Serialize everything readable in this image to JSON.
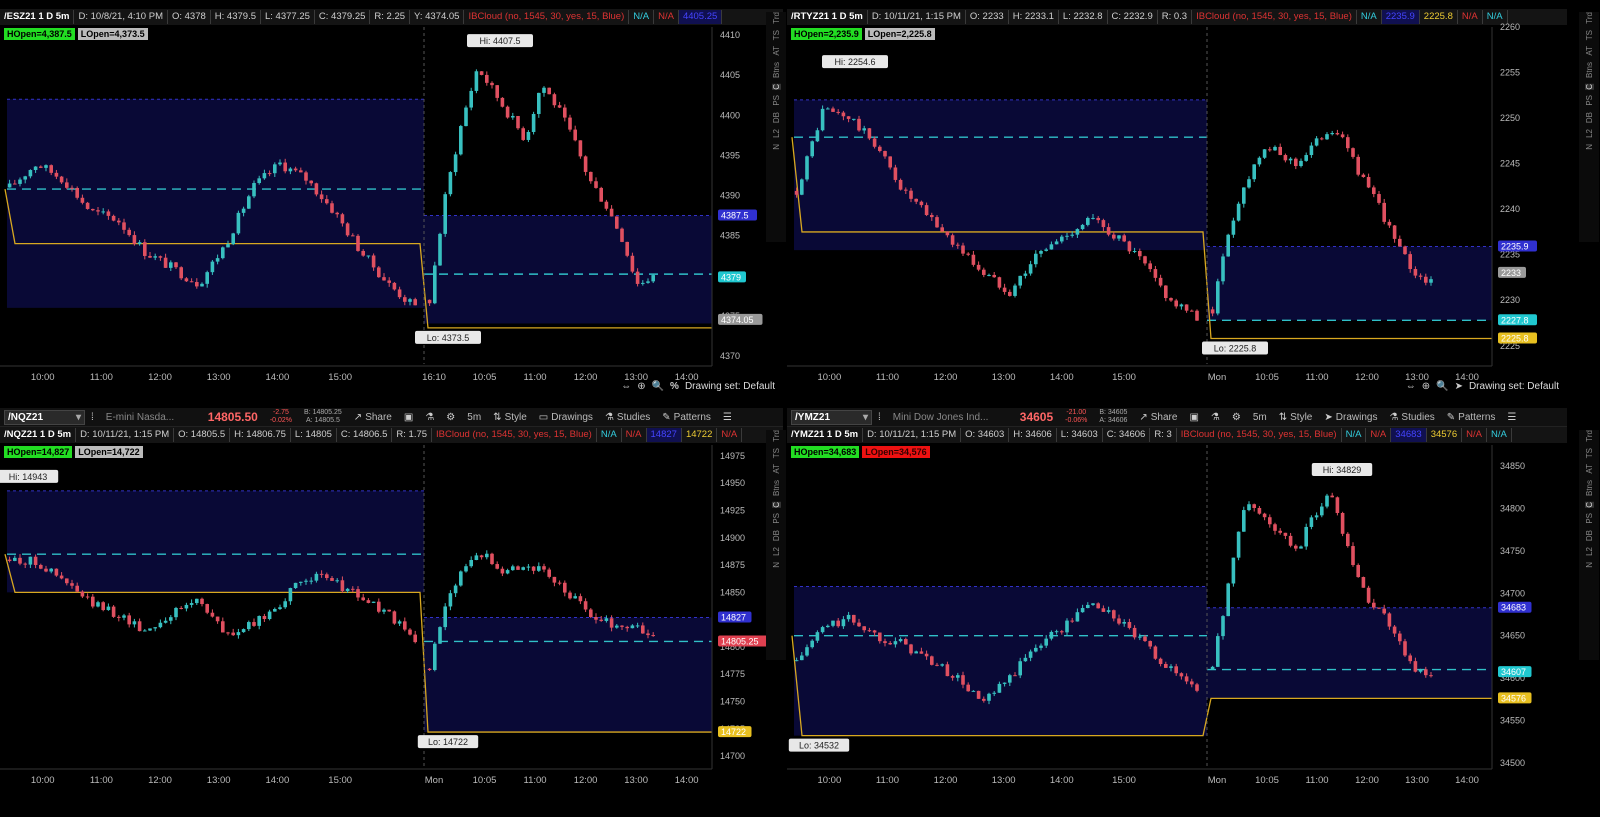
{
  "panes": [
    {
      "id": "es",
      "info": [
        "/ESZ21 1 D 5m",
        "D: 10/8/21, 4:10 PM",
        "O: 4378",
        "H: 4379.5",
        "L: 4377.25",
        "C: 4379.25",
        "R: 2.25",
        "Y: 4374.05"
      ],
      "info_red": "IBCloud (no, 1545, 30, yes, 15, Blue)",
      "info_tail": [
        "N/A",
        "N/A",
        "4405.25"
      ],
      "hopen": "HOpen=4,387.5",
      "lopen": "LOpen=4,373.5",
      "hi": "Hi: 4407.5",
      "lo": "Lo: 4373.5",
      "yticks": [
        "4410",
        "4405",
        "4400",
        "4395",
        "4390",
        "4385",
        "4380",
        "4375",
        "4370"
      ],
      "ytick_vals": [
        4410,
        4405,
        4400,
        4395,
        4390,
        4385,
        4380,
        4375,
        4370
      ],
      "ymin": 4369,
      "ymax": 4411,
      "xticks": [
        "10:00",
        "11:00",
        "12:00",
        "13:00",
        "14:00",
        "15:00",
        "16:10",
        "10:05",
        "11:00",
        "12:00",
        "13:00",
        "14:00"
      ],
      "price_tags": [
        {
          "label": "4387.5",
          "value": 4387.5,
          "color": "#3030d0"
        },
        {
          "label": "4379",
          "value": 4379.8,
          "color": "#20c8d0"
        },
        {
          "label": "4374.05",
          "value": 4374.5,
          "color": "#999"
        }
      ]
    },
    {
      "id": "rty",
      "info": [
        "/RTYZ21 1 D 5m",
        "D: 10/11/21, 1:15 PM",
        "O: 2233",
        "H: 2233.1",
        "L: 2232.8",
        "C: 2232.9",
        "R: 0.3"
      ],
      "info_red": "IBCloud (no, 1545, 30, yes, 15, Blue)",
      "info_tail": [
        "N/A",
        "2235.9",
        "2225.8",
        "N/A",
        "N/A"
      ],
      "hopen": "HOpen=2,235.9",
      "lopen": "LOpen=2,225.8",
      "hi": "Hi: 2254.6",
      "lo": "Lo: 2225.8",
      "yticks": [
        "2260",
        "2255",
        "2250",
        "2245",
        "2240",
        "2235",
        "2230",
        "2225"
      ],
      "ytick_vals": [
        2260,
        2255,
        2250,
        2245,
        2240,
        2235,
        2230,
        2225
      ],
      "ymin": 2223,
      "ymax": 2260,
      "xticks": [
        "10:00",
        "11:00",
        "12:00",
        "13:00",
        "14:00",
        "15:00",
        "Mon",
        "10:05",
        "11:00",
        "12:00",
        "13:00",
        "14:00"
      ],
      "price_tags": [
        {
          "label": "2235.9",
          "value": 2235.9,
          "color": "#3030d0"
        },
        {
          "label": "2233",
          "value": 2233,
          "color": "#999"
        },
        {
          "label": "2227.8",
          "value": 2227.8,
          "color": "#20c8d0"
        },
        {
          "label": "2225.8",
          "value": 2225.8,
          "color": "#e8c020"
        }
      ]
    },
    {
      "id": "nq",
      "info": [
        "/NQZ21 1 D 5m",
        "D: 10/11/21, 1:15 PM",
        "O: 14805.5",
        "H: 14806.75",
        "L: 14805",
        "C: 14806.5",
        "R: 1.75"
      ],
      "info_red": "IBCloud (no, 1545, 30, yes, 15, Blue)",
      "info_tail": [
        "N/A",
        "N/A",
        "14827",
        "14722",
        "N/A"
      ],
      "hopen": "HOpen=14,827",
      "lopen": "LOpen=14,722",
      "hi": "Hi: 14943",
      "lo": "Lo: 14722",
      "yticks": [
        "14975",
        "14950",
        "14925",
        "14900",
        "14875",
        "14850",
        "14825",
        "14800",
        "14775",
        "14750",
        "14725",
        "14700"
      ],
      "ytick_vals": [
        14975,
        14950,
        14925,
        14900,
        14875,
        14850,
        14825,
        14800,
        14775,
        14750,
        14725,
        14700
      ],
      "ymin": 14690,
      "ymax": 14985,
      "xticks": [
        "10:00",
        "11:00",
        "12:00",
        "13:00",
        "14:00",
        "15:00",
        "Mon",
        "10:05",
        "11:00",
        "12:00",
        "13:00",
        "14:00"
      ],
      "price_tags": [
        {
          "label": "14827",
          "value": 14827,
          "color": "#3030d0"
        },
        {
          "label": "14805.25",
          "value": 14805,
          "color": "#e04050"
        },
        {
          "label": "14722",
          "value": 14722,
          "color": "#e8c020"
        }
      ]
    },
    {
      "id": "ym",
      "info": [
        "/YMZ21 1 D 5m",
        "D: 10/11/21, 1:15 PM",
        "O: 34603",
        "H: 34606",
        "L: 34603",
        "C: 34606",
        "R: 3"
      ],
      "info_red": "IBCloud (no, 1545, 30, yes, 15, Blue)",
      "info_tail": [
        "N/A",
        "N/A",
        "34683",
        "34576",
        "N/A",
        "N/A"
      ],
      "hopen": "HOpen=34,683",
      "lopen": "LOpen=34,576",
      "hi": "Hi: 34829",
      "lo": "Lo: 34532",
      "yticks": [
        "34850",
        "34800",
        "34750",
        "34700",
        "34650",
        "34600",
        "34550",
        "34500"
      ],
      "ytick_vals": [
        34850,
        34800,
        34750,
        34700,
        34650,
        34600,
        34550,
        34500
      ],
      "ymin": 34495,
      "ymax": 34875,
      "xticks": [
        "10:00",
        "11:00",
        "12:00",
        "13:00",
        "14:00",
        "15:00",
        "Mon",
        "10:05",
        "11:00",
        "12:00",
        "13:00",
        "14:00"
      ],
      "price_tags": [
        {
          "label": "34683",
          "value": 34683,
          "color": "#3030d0"
        },
        {
          "label": "34607",
          "value": 34607,
          "color": "#20c8d0"
        },
        {
          "label": "34576",
          "value": 34576,
          "color": "#e8c020"
        }
      ]
    }
  ],
  "toolbars": [
    {
      "symbol": "/NQZ21",
      "desc": "E-mini Nasda...",
      "price": "14805.50",
      "chg": "-2.75",
      "chg_pct": "-0.02%",
      "bid": "B: 14805.25",
      "ask": "A: 14805.5"
    },
    {
      "symbol": "/YMZ21",
      "desc": "Mini Dow Jones Ind...",
      "price": "34605",
      "chg": "-21.00",
      "chg_pct": "-0.06%",
      "bid": "B: 34605",
      "ask": "A: 34606"
    }
  ],
  "toolbar_labels": {
    "share": "Share",
    "timeframe": "5m",
    "style": "Style",
    "drawings": "Drawings",
    "studies": "Studies",
    "patterns": "Patterns"
  },
  "drawing_set": "Drawing set: Default",
  "side_tabs": [
    "Trd",
    "TS",
    "AT",
    "Btns",
    "C",
    "PS",
    "DB",
    "L2",
    "N"
  ]
}
